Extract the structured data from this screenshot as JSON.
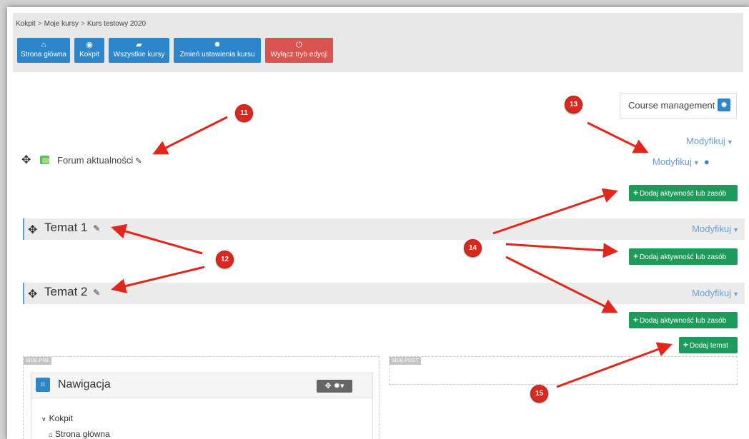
{
  "breadcrumb": [
    "Kokpit",
    "Moje kursy",
    "Kurs testowy 2020"
  ],
  "breadcrumb_sep": ">",
  "nav_buttons": [
    {
      "label": "Strona główna",
      "icon": "home-icon",
      "glyph": "⌂"
    },
    {
      "label": "Kokpit",
      "icon": "dashboard-icon",
      "glyph": "◉"
    },
    {
      "label": "Wszystkie kursy",
      "icon": "book-icon",
      "glyph": "▰"
    },
    {
      "label": "Zmień ustawienia kursu",
      "icon": "gear-icon",
      "glyph": "✹"
    },
    {
      "label": "Wyłącz tryb edycji",
      "icon": "power-icon",
      "glyph": "⏻"
    }
  ],
  "colors": {
    "nav_blue": "#2c86c9",
    "nav_red": "#d9534f",
    "add_green": "#1e9a5b",
    "badge_red": "#d9281e",
    "link_blue": "#6aa0d5"
  },
  "course_management": {
    "label": "Course management",
    "icon": "gear-icon"
  },
  "modify_label": "Modyfikuj",
  "forum": {
    "label": "Forum aktualności"
  },
  "add_activity_label": "Dodaj aktywność lub zasób",
  "add_topic_label": "Dodaj temat",
  "topics": [
    {
      "title": "Temat 1"
    },
    {
      "title": "Temat 2"
    }
  ],
  "regions": {
    "side_pre": "SIDE-PRE",
    "side_post": "SIDE-POST"
  },
  "navigation_block": {
    "title": "Nawigacja",
    "items": [
      "Kokpit",
      "Strona główna"
    ]
  },
  "badges": [
    "11",
    "12",
    "13",
    "14",
    "15"
  ]
}
